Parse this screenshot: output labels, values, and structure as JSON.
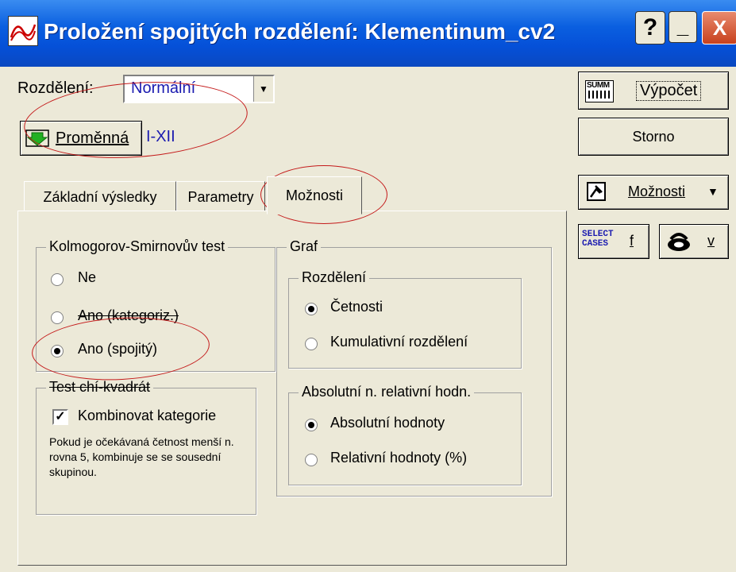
{
  "window": {
    "title": "Proložení spojitých rozdělení: Klementinum_cv2",
    "help_label": "?",
    "minimize_label": "_",
    "close_label": "X"
  },
  "top": {
    "distribution_label": "Rozdělení:",
    "distribution_value": "Normální",
    "variable_button": "Proměnná",
    "variable_value": "I-XII"
  },
  "tabs": [
    {
      "label": "Základní výsledky"
    },
    {
      "label": "Parametry"
    },
    {
      "label": "Možnosti"
    }
  ],
  "ks_group": {
    "legend": "Kolmogorov-Smirnovův test",
    "options": [
      {
        "label": "Ne",
        "selected": false
      },
      {
        "label": "Ano (kategoriz.)",
        "selected": false
      },
      {
        "label": "Ano (spojitý)",
        "selected": true
      }
    ]
  },
  "chi_group": {
    "legend": "Test chí-kvadrát",
    "checkbox_label": "Kombinovat kategorie",
    "checked": true,
    "note": "Pokud je očekávaná četnost menší n. rovna 5, kombinuje se se sousední skupinou."
  },
  "graph_group": {
    "legend": "Graf",
    "dist_legend": "Rozdělení",
    "dist_options": [
      {
        "label": "Četnosti",
        "selected": true
      },
      {
        "label": "Kumulativní rozdělení",
        "selected": false
      }
    ],
    "abs_legend": "Absolutní n. relativní hodn.",
    "abs_options": [
      {
        "label": "Absolutní hodnoty",
        "selected": true
      },
      {
        "label": "Relativní hodnoty (%)",
        "selected": false
      }
    ]
  },
  "right": {
    "summ_icon_label": "SUMM",
    "compute_button": "Výpočet",
    "cancel_button": "Storno",
    "options_button": "Možnosti",
    "select_cases_label_1": "SELECT",
    "select_cases_label_2": "CASES",
    "select_key": "f",
    "weight_key": "v"
  }
}
